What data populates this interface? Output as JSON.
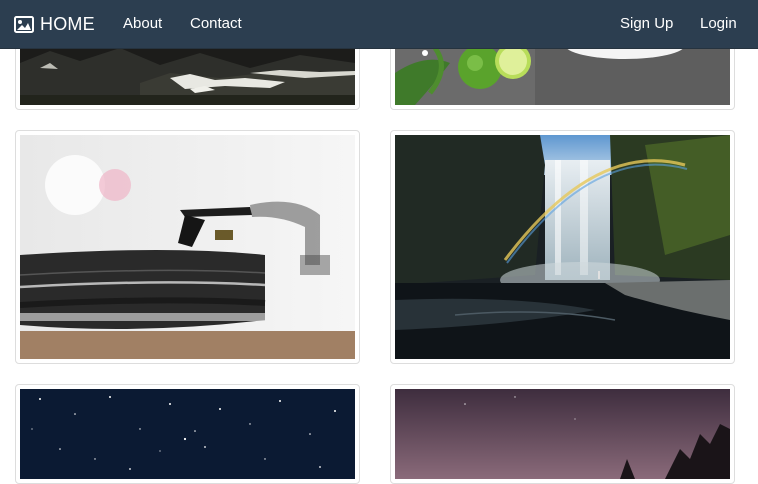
{
  "navbar": {
    "brand_icon": "image-icon",
    "brand_label": "HOME",
    "links": {
      "about": "About",
      "contact": "Contact",
      "signup": "Sign Up",
      "login": "Login"
    },
    "background": "#2c3e50",
    "text_color": "#ffffff"
  },
  "gallery": {
    "thumbnail_border": "#dddddd"
  }
}
